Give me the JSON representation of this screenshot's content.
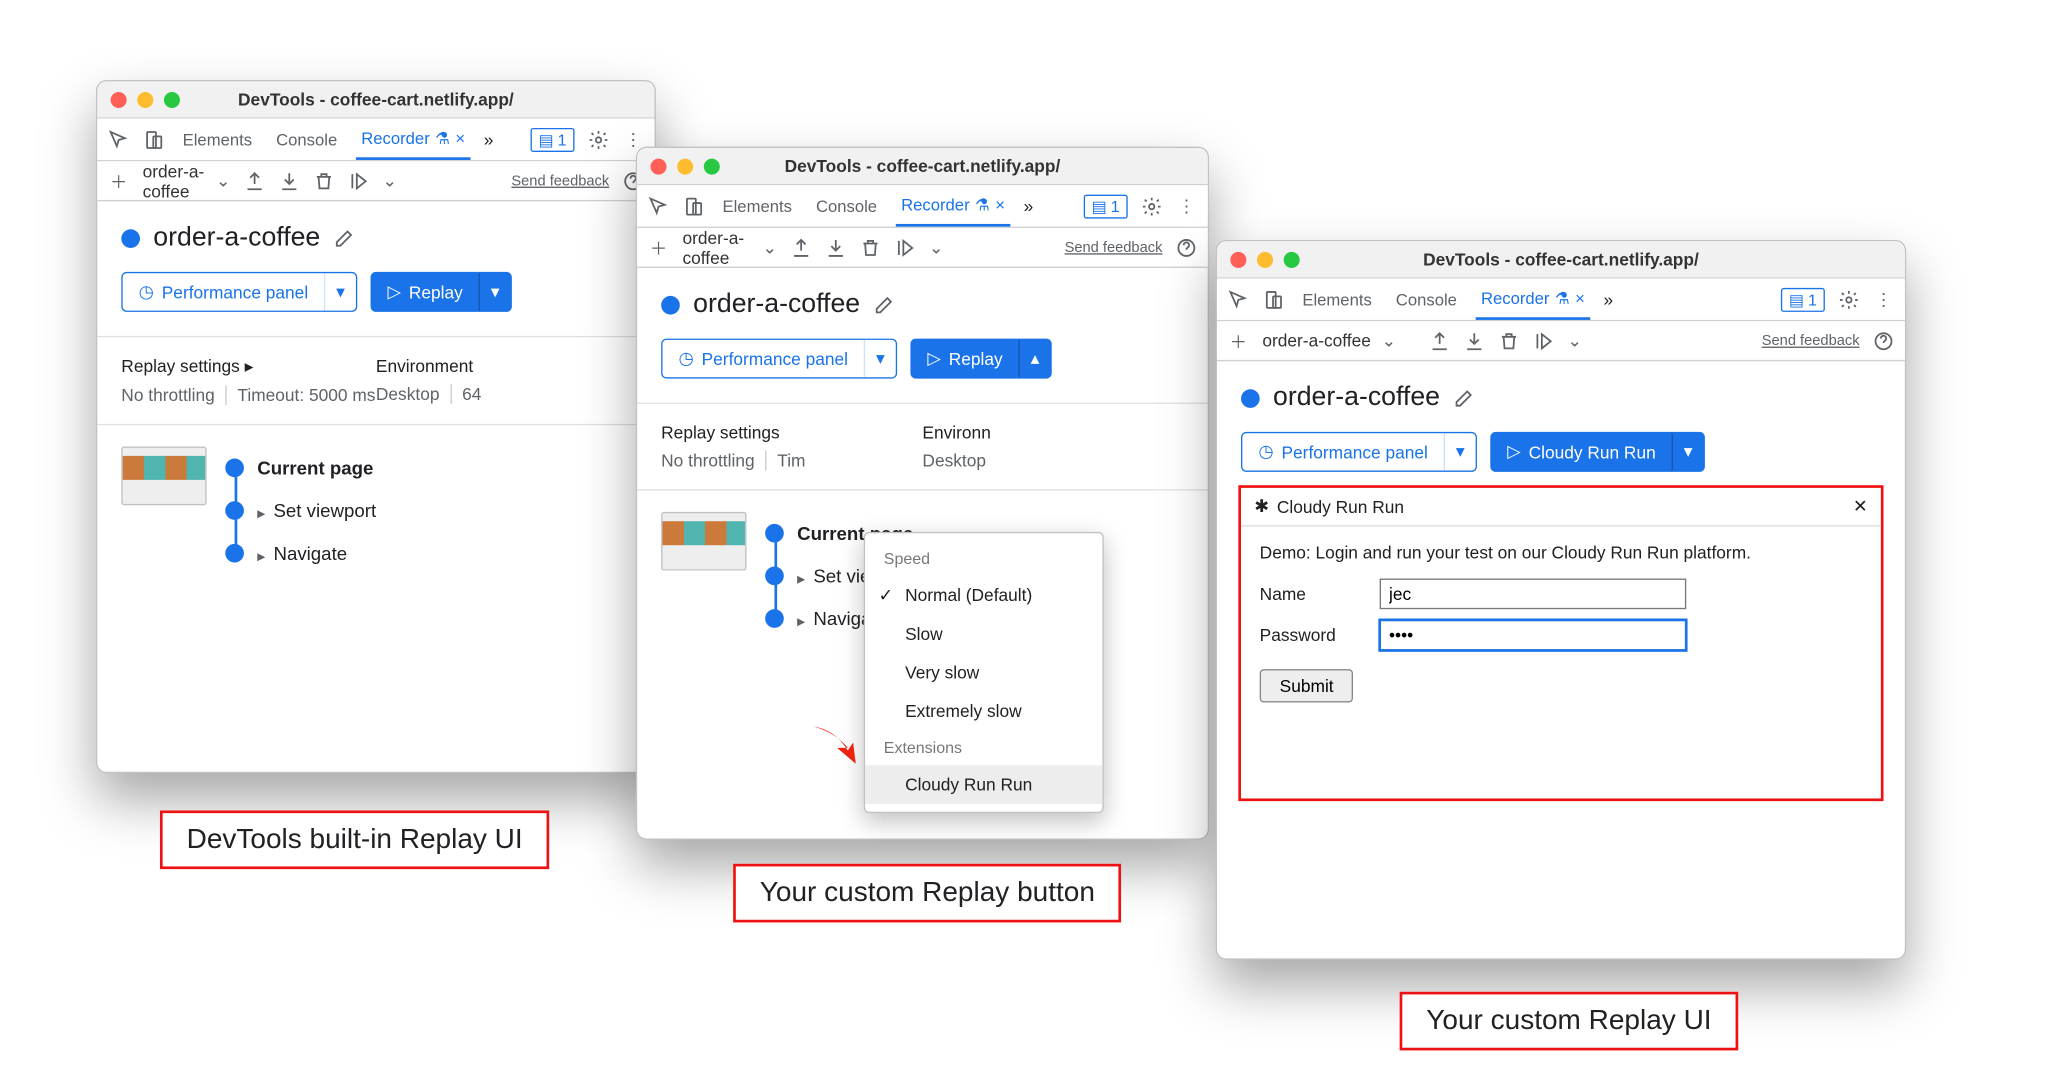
{
  "app_title": "DevTools - coffee-cart.netlify.app/",
  "tabs": {
    "elements": "Elements",
    "console": "Console",
    "recorder": "Recorder"
  },
  "badge_count": "1",
  "recording_name": "order-a-coffee",
  "feedback": "Send feedback",
  "perf_panel": "Performance panel",
  "replay": "Replay",
  "replay_custom": "Cloudy Run Run",
  "settings": {
    "h1": "Replay settings",
    "throttle": "No throttling",
    "timeout": "Timeout: 5000 ms",
    "h2": "Environment",
    "env1": "Desktop",
    "env2": "64"
  },
  "steps": {
    "current": "Current page",
    "viewport": "Set viewport",
    "navigate": "Navigate"
  },
  "menu": {
    "speed": "Speed",
    "normal": "Normal (Default)",
    "slow": "Slow",
    "very": "Very slow",
    "extreme": "Extremely slow",
    "ext": "Extensions",
    "ext_item": "Cloudy Run Run"
  },
  "popup": {
    "title": "Cloudy Run Run",
    "desc": "Demo: Login and run your test on our Cloudy Run Run platform.",
    "name_lbl": "Name",
    "name_val": "jec",
    "pass_lbl": "Password",
    "pass_val": "••••",
    "submit": "Submit"
  },
  "captions": {
    "c1": "DevTools built-in Replay UI",
    "c2": "Your custom Replay button",
    "c3": "Your custom Replay UI"
  }
}
